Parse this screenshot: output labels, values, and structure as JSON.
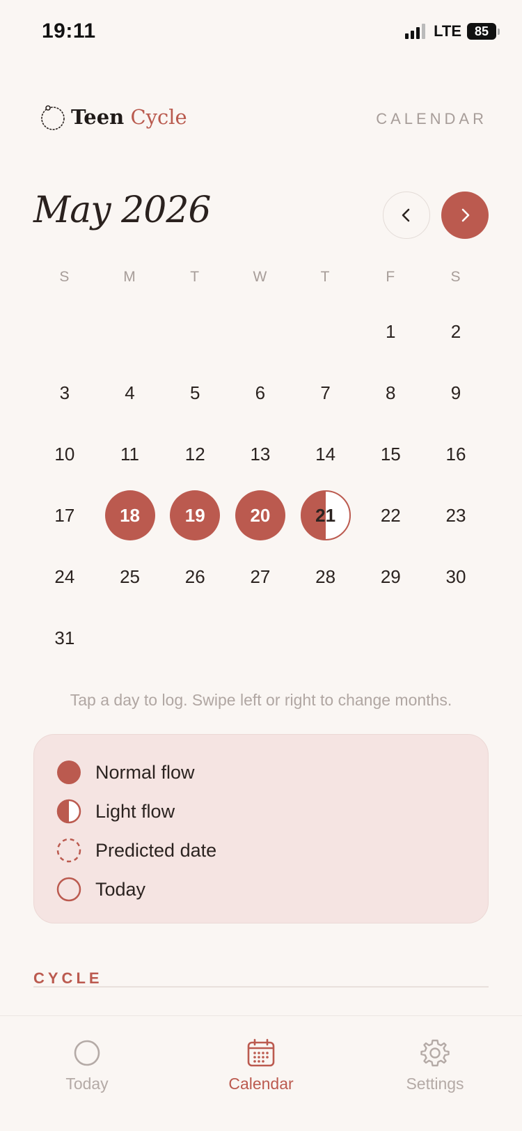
{
  "status_bar": {
    "time": "19:11",
    "network": "LTE",
    "battery": "85"
  },
  "header": {
    "logo_teen": "Teen",
    "logo_cycle": "Cycle",
    "section": "CALENDAR"
  },
  "calendar": {
    "month_title": "May 2026",
    "weekdays": [
      "S",
      "M",
      "T",
      "W",
      "T",
      "F",
      "S"
    ],
    "weeks": [
      [
        null,
        null,
        null,
        null,
        null,
        {
          "d": "1"
        },
        {
          "d": "2"
        }
      ],
      [
        {
          "d": "3"
        },
        {
          "d": "4"
        },
        {
          "d": "5"
        },
        {
          "d": "6"
        },
        {
          "d": "7"
        },
        {
          "d": "8"
        },
        {
          "d": "9"
        }
      ],
      [
        {
          "d": "10"
        },
        {
          "d": "11"
        },
        {
          "d": "12"
        },
        {
          "d": "13"
        },
        {
          "d": "14"
        },
        {
          "d": "15"
        },
        {
          "d": "16"
        }
      ],
      [
        {
          "d": "17"
        },
        {
          "d": "18",
          "s": "normal"
        },
        {
          "d": "19",
          "s": "normal"
        },
        {
          "d": "20",
          "s": "normal"
        },
        {
          "d": "21",
          "s": "light"
        },
        {
          "d": "22"
        },
        {
          "d": "23"
        }
      ],
      [
        {
          "d": "24"
        },
        {
          "d": "25"
        },
        {
          "d": "26"
        },
        {
          "d": "27"
        },
        {
          "d": "28"
        },
        {
          "d": "29"
        },
        {
          "d": "30"
        }
      ],
      [
        {
          "d": "31"
        },
        null,
        null,
        null,
        null,
        null,
        null
      ]
    ]
  },
  "hint": "Tap a day to log. Swipe left or right to change months.",
  "legend": [
    {
      "icon": "normal-flow-icon",
      "label": "Normal flow"
    },
    {
      "icon": "light-flow-icon",
      "label": "Light flow"
    },
    {
      "icon": "predicted-date-icon",
      "label": "Predicted date"
    },
    {
      "icon": "today-icon",
      "label": "Today"
    }
  ],
  "cycle_section": {
    "title": "CYCLE"
  },
  "tabs": [
    {
      "label": "Today",
      "icon": "circle-icon",
      "active": false
    },
    {
      "label": "Calendar",
      "icon": "calendar-icon",
      "active": true
    },
    {
      "label": "Settings",
      "icon": "gear-icon",
      "active": false
    }
  ],
  "colors": {
    "accent": "#bb5a4f",
    "background": "#faf6f3",
    "legend_bg": "#f5e4e2"
  }
}
